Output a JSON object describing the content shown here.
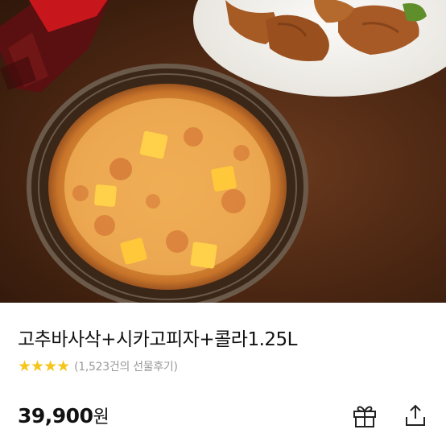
{
  "product": {
    "image_alt": "pizza-chicken-cola-photo",
    "title": "고추바사삭+시카고피자+콜라1.25L",
    "rating_stars": "★★★★",
    "rating_value": 4,
    "review_count": "(1,523건의 선물후기)",
    "price": "39,900",
    "price_unit": "원"
  },
  "actions": {
    "gift_icon": "gift-icon",
    "share_icon": "share-icon"
  },
  "colors": {
    "star": "#f5c518",
    "text": "#111111",
    "muted": "#999999"
  }
}
